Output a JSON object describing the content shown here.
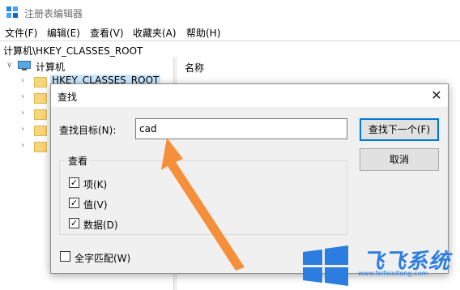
{
  "window": {
    "title": "注册表编辑器",
    "icon": "regedit-icon"
  },
  "menu": [
    "文件(F)",
    "编辑(E)",
    "查看(V)",
    "收藏夹(A)",
    "帮助(H)"
  ],
  "address": "计算机\\HKEY_CLASSES_ROOT",
  "tree": {
    "root": "计算机",
    "first_key": "HKEY_CLASSES_ROOT"
  },
  "right_pane": {
    "column_name": "名称"
  },
  "dialog": {
    "title": "查找",
    "find_label": "查找目标(N):",
    "find_value": "cad",
    "find_next": "查找下一个(F)",
    "cancel": "取消",
    "lookat_title": "查看",
    "options": [
      {
        "label": "项(K)",
        "checked": true
      },
      {
        "label": "值(V)",
        "checked": true
      },
      {
        "label": "数据(D)",
        "checked": true
      }
    ],
    "match_whole": {
      "label": "全字匹配(W)",
      "checked": false
    }
  },
  "watermark": {
    "brand": "飞飞系统",
    "url": "www.feifeixitong.com"
  },
  "colors": {
    "accent": "#0078d7",
    "arrow": "#f5892e",
    "watermark": "#2b7de0"
  }
}
